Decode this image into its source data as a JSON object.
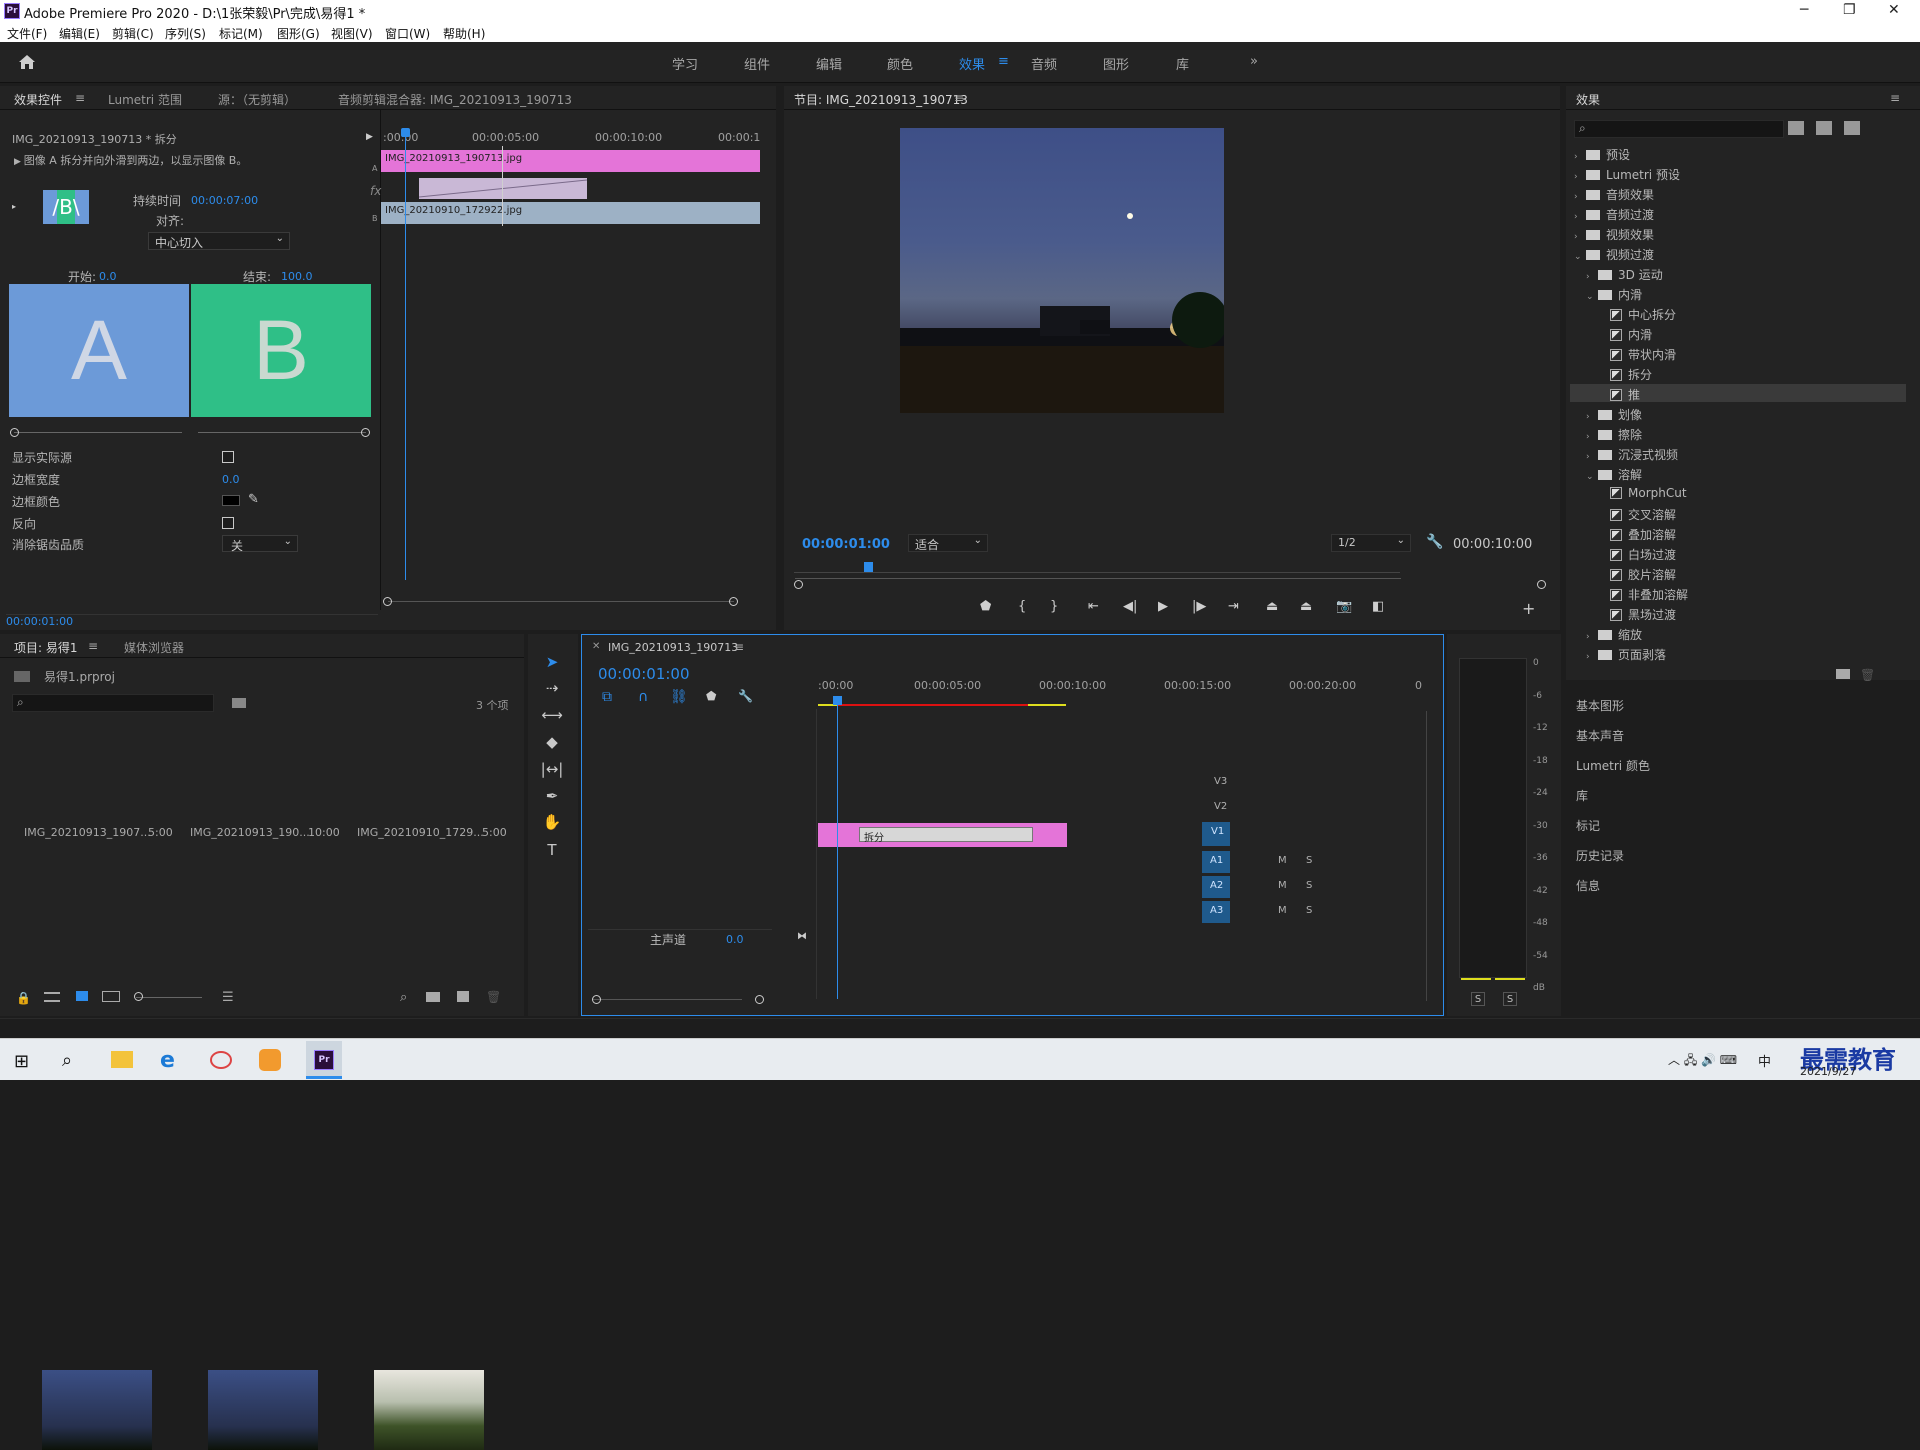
{
  "window": {
    "title": "Adobe Premiere Pro 2020 - D:\\1张荣毅\\Pr\\完成\\易得1 *",
    "app_icon": "Pr"
  },
  "menu": [
    "文件(F)",
    "编辑(E)",
    "剪辑(C)",
    "序列(S)",
    "标记(M)",
    "图形(G)",
    "视图(V)",
    "窗口(W)",
    "帮助(H)"
  ],
  "workspaces": [
    "学习",
    "组件",
    "编辑",
    "颜色",
    "效果",
    "音频",
    "图形",
    "库"
  ],
  "effect_controls": {
    "tabs": [
      "效果控件",
      "Lumetri 范围",
      "源：（无剪辑）",
      "音频剪辑混合器: IMG_20210913_190713"
    ],
    "clip_header": "IMG_20210913_190713 * 拆分",
    "description": "图像 A 拆分并向外滑到两边，以显示图像 B。",
    "duration_label": "持续时间",
    "duration_value": "00:00:07:00",
    "align_label": "对齐:",
    "align_value": "中心切入",
    "start_label": "开始:",
    "start_value": "0.0",
    "end_label": "结束:",
    "end_value": "100.0",
    "letter_a": "A",
    "letter_b": "B",
    "props": [
      {
        "label": "显示实际源",
        "type": "checkbox"
      },
      {
        "label": "边框宽度",
        "value": "0.0"
      },
      {
        "label": "边框颜色",
        "type": "color"
      },
      {
        "label": "反向",
        "type": "checkbox"
      },
      {
        "label": "消除锯齿品质",
        "value": "关"
      }
    ],
    "timecode": "00:00:01:00",
    "ruler": [
      ":00:00",
      "00:00:05:00",
      "00:00:10:00",
      "00:00:1"
    ],
    "clip_a": "IMG_20210913_190713.jpg",
    "clip_b": "IMG_20210910_172922.jpg",
    "fx_label": "fx",
    "track_a": "A",
    "track_b": "B"
  },
  "program": {
    "title": "节目: IMG_20210913_190713",
    "timecode": "00:00:01:00",
    "fit": "适合",
    "quality": "1/2",
    "duration": "00:00:10:00"
  },
  "effects": {
    "title": "效果",
    "tree": [
      {
        "label": "预设",
        "level": 0,
        "open": false
      },
      {
        "label": "Lumetri 预设",
        "level": 0,
        "open": false
      },
      {
        "label": "音频效果",
        "level": 0,
        "open": false
      },
      {
        "label": "音频过渡",
        "level": 0,
        "open": false
      },
      {
        "label": "视频效果",
        "level": 0,
        "open": false
      },
      {
        "label": "视频过渡",
        "level": 0,
        "open": true
      },
      {
        "label": "3D 运动",
        "level": 1,
        "open": false
      },
      {
        "label": "内滑",
        "level": 1,
        "open": true
      },
      {
        "label": "中心拆分",
        "level": 2,
        "fx": true
      },
      {
        "label": "内滑",
        "level": 2,
        "fx": true
      },
      {
        "label": "带状内滑",
        "level": 2,
        "fx": true
      },
      {
        "label": "拆分",
        "level": 2,
        "fx": true
      },
      {
        "label": "推",
        "level": 2,
        "fx": true,
        "selected": true
      },
      {
        "label": "划像",
        "level": 1,
        "open": false
      },
      {
        "label": "擦除",
        "level": 1,
        "open": false
      },
      {
        "label": "沉浸式视频",
        "level": 1,
        "open": false
      },
      {
        "label": "溶解",
        "level": 1,
        "open": true
      },
      {
        "label": "MorphCut",
        "level": 2,
        "fx": true
      },
      {
        "label": "交叉溶解",
        "level": 2,
        "fx": true
      },
      {
        "label": "叠加溶解",
        "level": 2,
        "fx": true
      },
      {
        "label": "白场过渡",
        "level": 2,
        "fx": true
      },
      {
        "label": "胶片溶解",
        "level": 2,
        "fx": true
      },
      {
        "label": "非叠加溶解",
        "level": 2,
        "fx": true
      },
      {
        "label": "黑场过渡",
        "level": 2,
        "fx": true
      },
      {
        "label": "缩放",
        "level": 1,
        "open": false
      },
      {
        "label": "页面剥落",
        "level": 1,
        "open": false
      }
    ],
    "side_panels": [
      "基本图形",
      "基本声音",
      "Lumetri 颜色",
      "库",
      "标记",
      "历史记录",
      "信息"
    ]
  },
  "project": {
    "tabs": [
      "项目: 易得1",
      "媒体浏览器"
    ],
    "file": "易得1.prproj",
    "count": "3 个项",
    "items": [
      {
        "name": "IMG_20210913_1907...",
        "dur": "5:00"
      },
      {
        "name": "IMG_20210913_190...",
        "dur": "10:00"
      },
      {
        "name": "IMG_20210910_1729...",
        "dur": "5:00"
      }
    ]
  },
  "timeline": {
    "tab": "IMG_20210913_190713",
    "timecode": "00:00:01:00",
    "ruler": [
      ":00:00",
      "00:00:05:00",
      "00:00:10:00",
      "00:00:15:00",
      "00:00:20:00",
      "0"
    ],
    "tracks": [
      "V3",
      "V2",
      "V1",
      "A1",
      "A2",
      "A3"
    ],
    "master": "主声道",
    "master_value": "0.0",
    "transition": "拆分",
    "m": "M",
    "s": "S"
  },
  "meter": {
    "scale": [
      "0",
      "-6",
      "-12",
      "-18",
      "-24",
      "-30",
      "-36",
      "-42",
      "-48",
      "-54",
      "dB"
    ],
    "solo": [
      "S",
      "S"
    ]
  },
  "taskbar": {
    "brand": "最需教育",
    "date": "2021/9/27",
    "ime": "中"
  }
}
